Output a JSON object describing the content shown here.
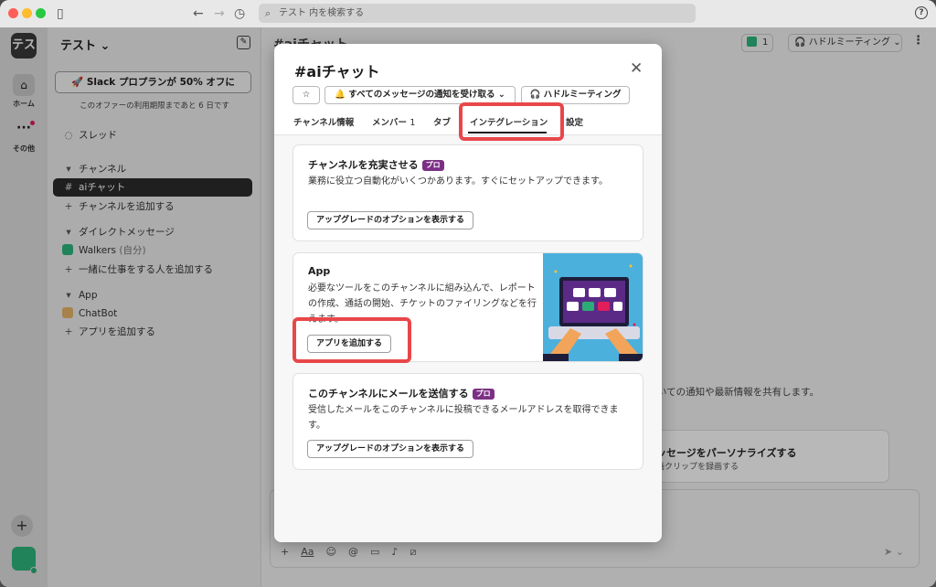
{
  "search": {
    "placeholder": "テスト 内を検索する"
  },
  "rail": {
    "workspace_initial": "テス",
    "home_label": "ホーム",
    "more_label": "その他"
  },
  "sidebar": {
    "workspace_name": "テスト",
    "promo_button": "Slack プロプランが 50% オフに",
    "promo_note": "このオファーの利用期限まであと 6 日です",
    "threads": "スレッド",
    "channels_header": "チャンネル",
    "channel_active": "aiチャット",
    "add_channel": "チャンネルを追加する",
    "dm_header": "ダイレクトメッセージ",
    "dm_user": "Walkers",
    "dm_user_suffix": "(自分)",
    "add_people": "一緒に仕事をする人を追加する",
    "app_header": "App",
    "app_item": "ChatBot",
    "add_app": "アプリを追加する"
  },
  "main": {
    "channel_title": "#aiチャット",
    "member_count": "1",
    "huddle": "ハドルミーティング",
    "info_text": "いての通知や最新情報を共有します。",
    "card_title": "ッセージをパーソナライズする",
    "card_sub": "画クリップを録画する"
  },
  "modal": {
    "title": "#aiチャット",
    "notify_button": "すべてのメッセージの通知を受け取る",
    "huddle_button": "ハドルミーティング",
    "tabs": {
      "info": "チャンネル情報",
      "members": "メンバー",
      "members_count": "1",
      "tabs": "タブ",
      "integrations": "インテグレーション",
      "settings": "設定"
    },
    "cards": {
      "enrich": {
        "title": "チャンネルを充実させる",
        "badge": "プロ",
        "desc": "業務に役立つ自動化がいくつかあります。すぐにセットアップできます。",
        "button": "アップグレードのオプションを表示する"
      },
      "app": {
        "title": "App",
        "desc": "必要なツールをこのチャンネルに組み込んで、レポートの作成、通話の開始、チケットのファイリングなどを行えます。",
        "button": "アプリを追加する"
      },
      "email": {
        "title": "このチャンネルにメールを送信する",
        "badge": "プロ",
        "desc": "受信したメールをこのチャンネルに投稿できるメールアドレスを取得できます。",
        "button": "アップグレードのオプションを表示する"
      }
    }
  },
  "colors": {
    "highlight": "#e8474a",
    "pro_badge": "#7c3085",
    "active_channel_bg": "#2c2c2c"
  }
}
